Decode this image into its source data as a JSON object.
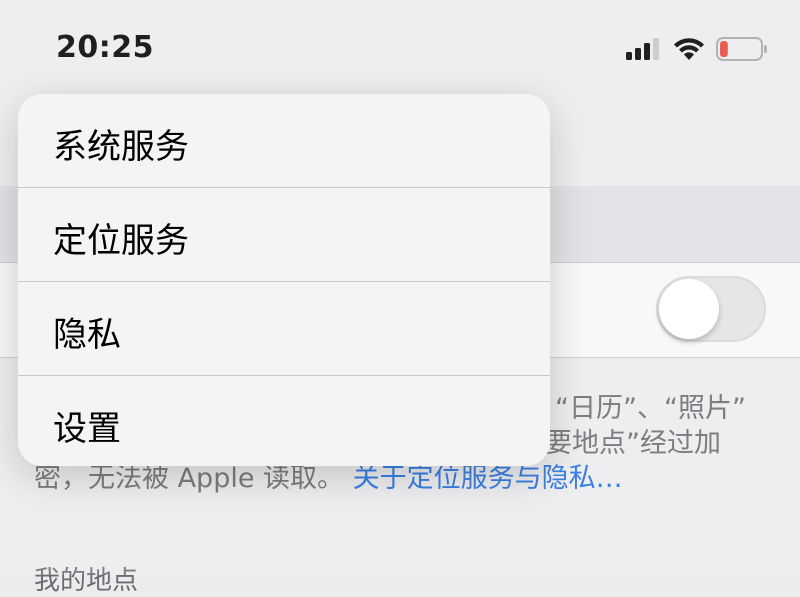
{
  "status_bar": {
    "time": "20:25",
    "signal_icon": "cellular-signal-icon",
    "wifi_icon": "wifi-icon",
    "battery_icon": "battery-low-icon",
    "battery_level": 0.2,
    "battery_color": "#e8483b"
  },
  "page": {
    "footer_line1": "“日历”、“照片”",
    "footer_line2": "要地点”经过加",
    "footer_line3_text": "密，无法被 Apple 读取。",
    "footer_link": "关于定位服务与隐私…",
    "section_my_places": "我的地点",
    "toggle_on": false,
    "link_color": "#1f6fe0"
  },
  "menu": {
    "items": [
      {
        "label": "系统服务"
      },
      {
        "label": "定位服务"
      },
      {
        "label": "隐私"
      },
      {
        "label": "设置"
      }
    ]
  }
}
